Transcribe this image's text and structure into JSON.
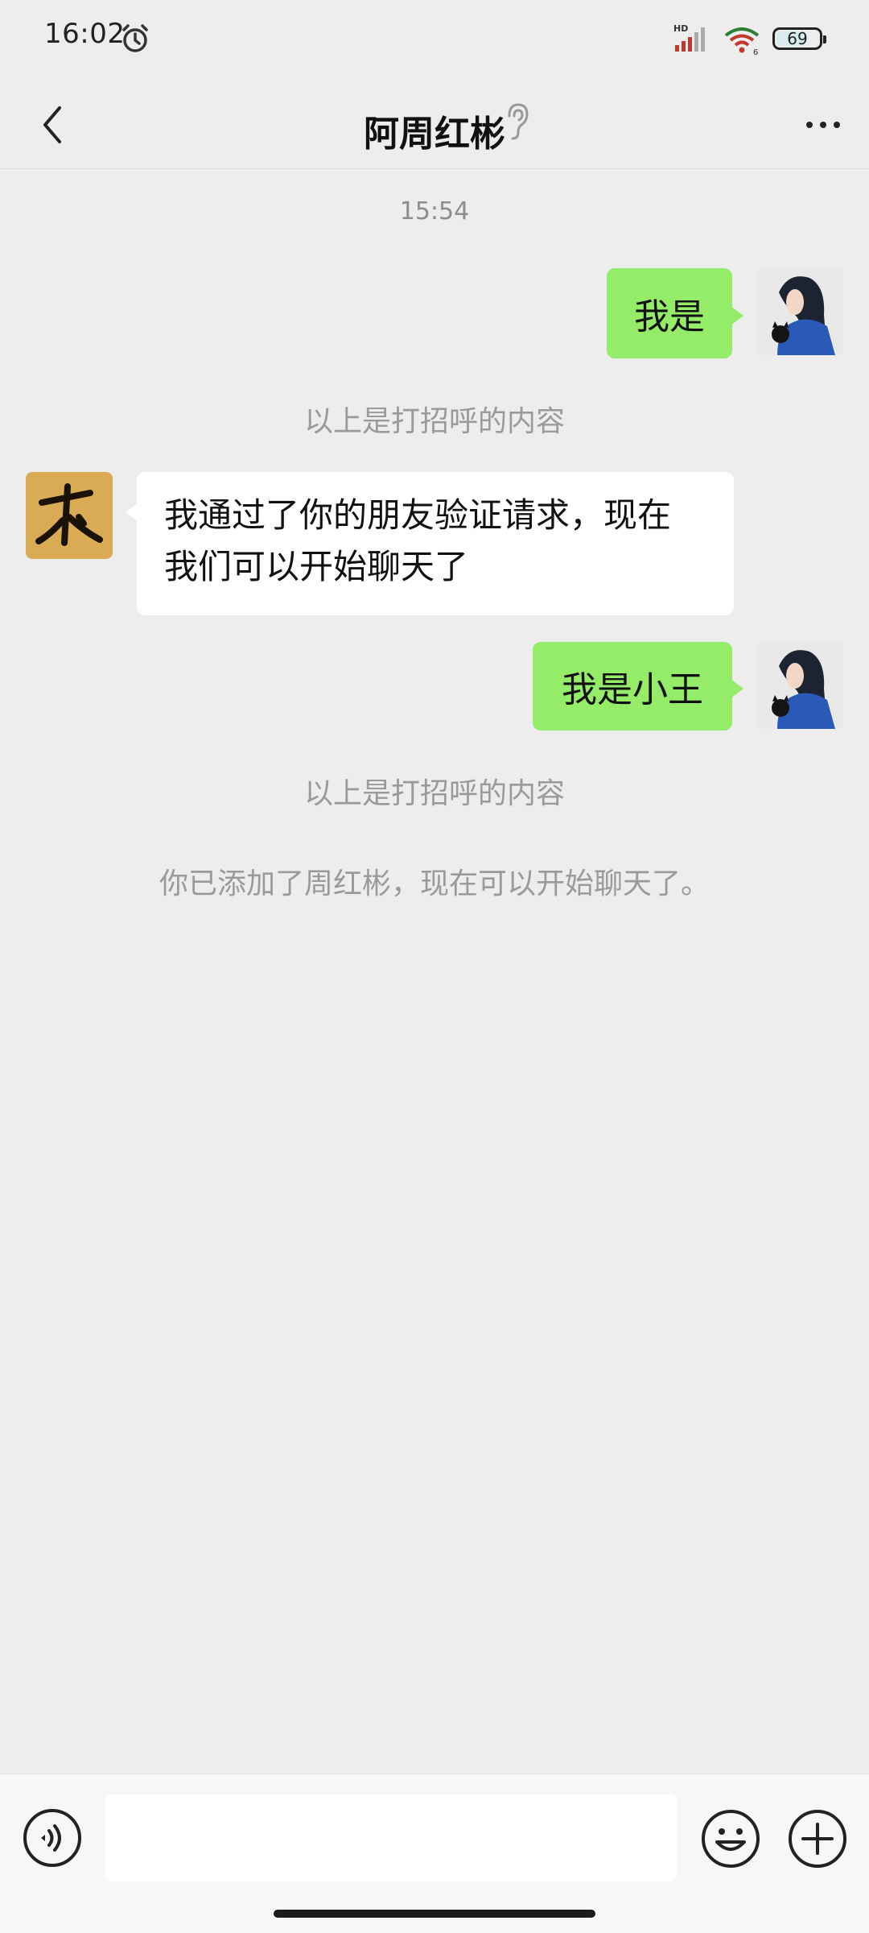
{
  "status_bar": {
    "time": "16:02",
    "battery": "69",
    "icons": [
      "alarm-icon",
      "signal-icon",
      "wifi-icon",
      "battery-icon"
    ]
  },
  "header": {
    "title": "阿周红彬",
    "back_icon": "chevron-left-icon",
    "ear_icon": "ear-icon",
    "more_icon": "more-icon"
  },
  "chat": {
    "timestamp": "15:54",
    "messages": [
      {
        "direction": "out",
        "text": "我是"
      },
      {
        "direction": "system",
        "text": "以上是打招呼的内容"
      },
      {
        "direction": "in",
        "line1": "我通过了你的朋友验证请求，现在",
        "line2": "我们可以开始聊天了"
      },
      {
        "direction": "out",
        "text": "我是小王"
      },
      {
        "direction": "system",
        "text": "以上是打招呼的内容"
      },
      {
        "direction": "system",
        "text": "你已添加了周红彬，现在可以开始聊天了。"
      }
    ]
  },
  "input_bar": {
    "value": "",
    "placeholder": "",
    "icons": [
      "voice-icon",
      "emoji-icon",
      "plus-icon"
    ]
  },
  "colors": {
    "background": "#ededed",
    "bubble_out": "#95ec69",
    "bubble_in": "#ffffff",
    "system_text": "#9a9a9a"
  }
}
